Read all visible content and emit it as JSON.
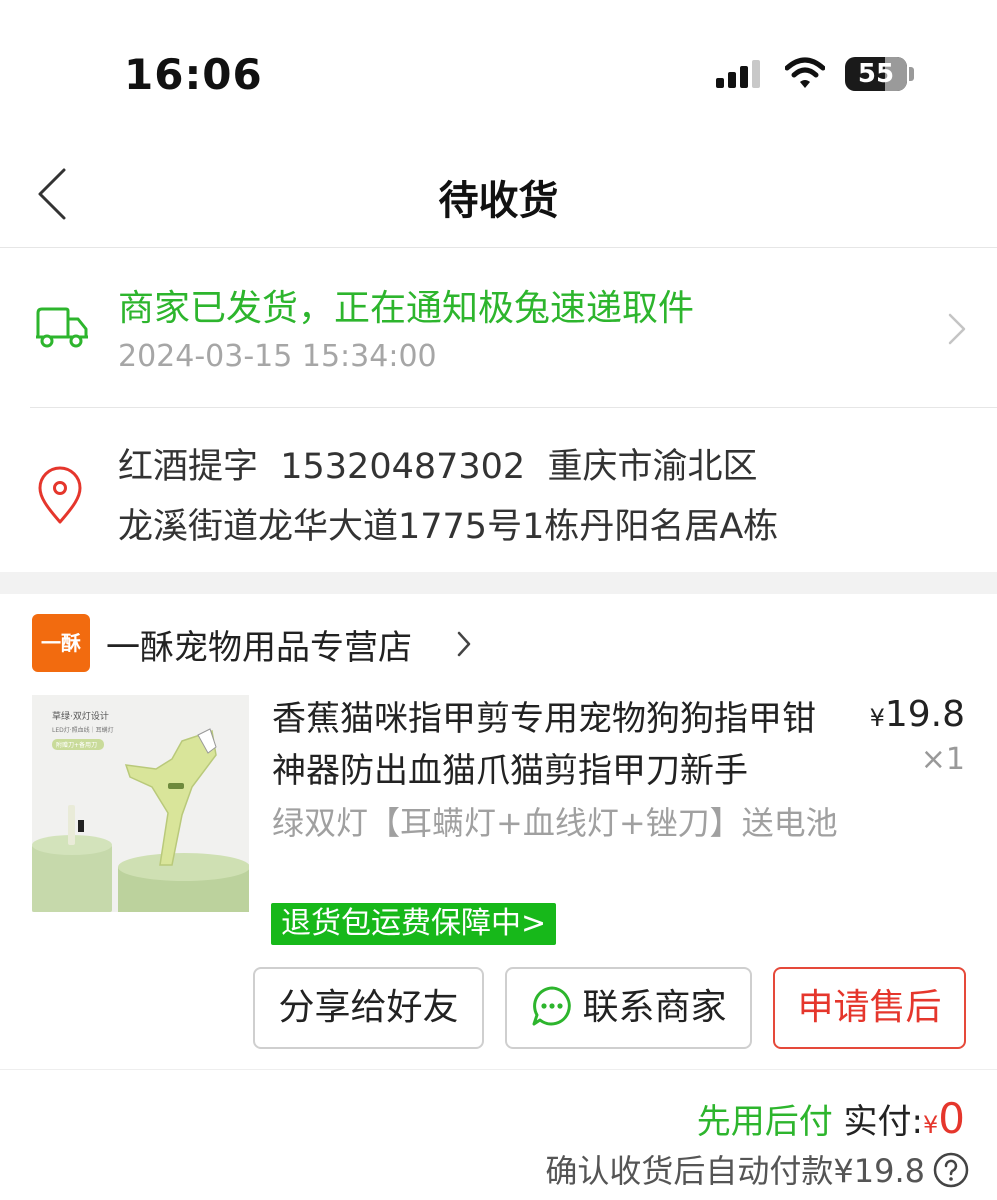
{
  "status_bar": {
    "time": "16:06",
    "battery": "55"
  },
  "nav": {
    "title": "待收货"
  },
  "logistics": {
    "status": "商家已发货，正在通知极兔速递取件",
    "time": "2024-03-15 15:34:00"
  },
  "address": {
    "line1": "红酒提字  15320487302  重庆市渝北区",
    "line2": "龙溪街道龙华大道1775号1栋丹阳名居A栋"
  },
  "shop": {
    "logo_text": "一酥",
    "name": "一酥宠物用品专营店"
  },
  "product": {
    "title": "香蕉猫咪指甲剪专用宠物狗狗指甲钳神器防出血猫爪猫剪指甲刀新手",
    "price_symbol": "¥",
    "price": "19.8",
    "quantity": "×1",
    "spec": "绿双灯【耳螨灯+血线灯+锉刀】送电池",
    "return_badge": "退货包运费保障中>",
    "image_text": {
      "line1": "草绿·双灯设计",
      "line2": "LED灯·照血线｜耳螨灯",
      "tag": "附赠刀+备用刀"
    }
  },
  "actions": {
    "share": "分享给好友",
    "contact": "联系商家",
    "after_sale": "申请售后"
  },
  "payment": {
    "pay_later": "先用后付",
    "paid_label": "实付:",
    "yen": "¥",
    "paid_amount": "0",
    "auto_pay_note": "确认收货后自动付款¥19.8"
  },
  "colors": {
    "green": "#2db52d",
    "red": "#e5362c",
    "shop_orange": "#f26b0f",
    "badge_green": "#17b81a"
  }
}
